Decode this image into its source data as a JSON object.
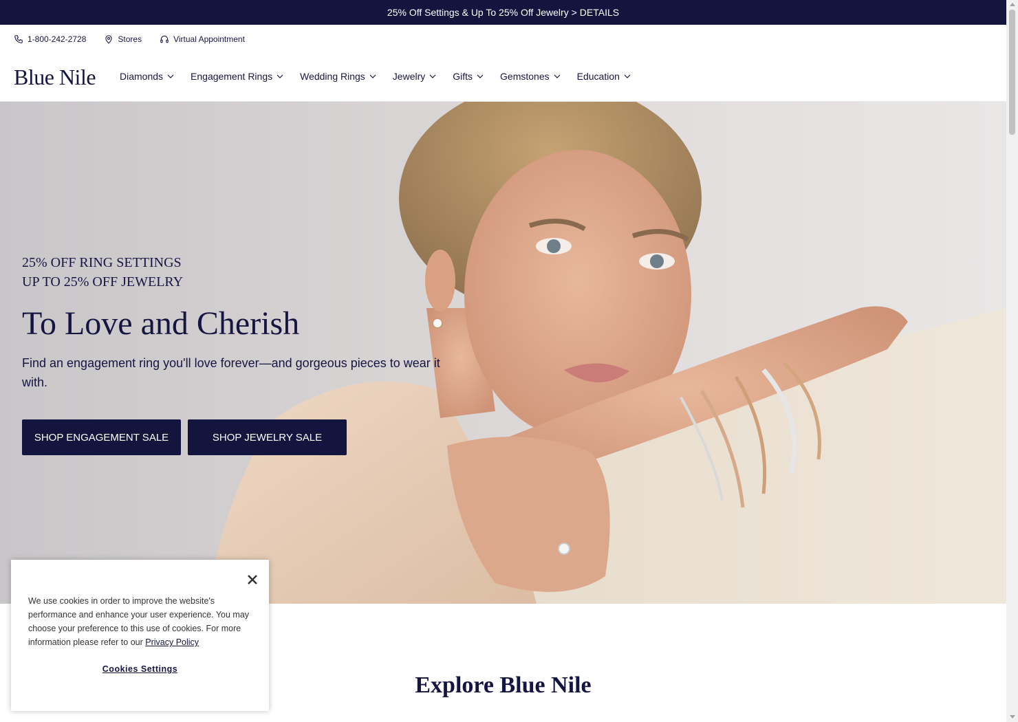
{
  "promo": {
    "text": "25% Off Settings & Up To 25% Off Jewelry >",
    "link": "DETAILS"
  },
  "utility": {
    "phone": "1-800-242-2728",
    "stores": "Stores",
    "appointment": "Virtual Appointment"
  },
  "brand": {
    "logo": "Blue Nile"
  },
  "nav": {
    "items": [
      {
        "label": "Diamonds"
      },
      {
        "label": "Engagement Rings"
      },
      {
        "label": "Wedding Rings"
      },
      {
        "label": "Jewelry"
      },
      {
        "label": "Gifts"
      },
      {
        "label": "Gemstones"
      },
      {
        "label": "Education"
      }
    ]
  },
  "hero": {
    "eyebrow_1": "25% OFF RING SETTINGS",
    "eyebrow_2": "UP TO 25% OFF JEWELRY",
    "title": "To Love and Cherish",
    "description": "Find an engagement ring you'll love forever—and gorgeous pieces to wear it with.",
    "button_1": "SHOP ENGAGEMENT SALE",
    "button_2": "SHOP JEWELRY SALE"
  },
  "explore": {
    "title": "Explore Blue Nile"
  },
  "cookie": {
    "text": "We use cookies in order to improve the website's performance and enhance your user experience. You may choose your preference to this use of cookies. For more information please refer to our",
    "link": "Privacy Policy",
    "settings": "Cookies Settings"
  },
  "colors": {
    "navy": "#13153f",
    "text": "#151542"
  }
}
